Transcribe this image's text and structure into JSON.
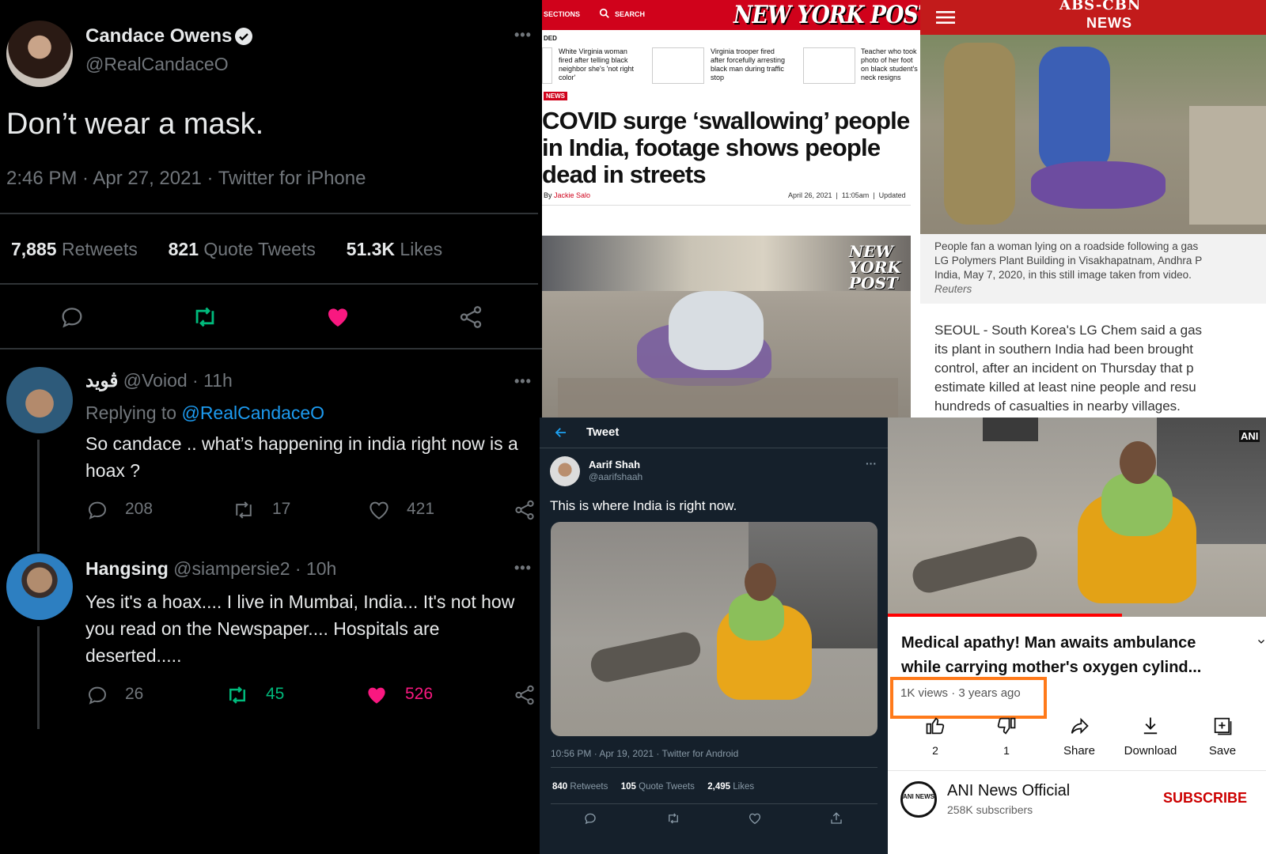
{
  "tweet_main": {
    "name": "Candace Owens",
    "handle": "@RealCandaceO",
    "text": "Don’t wear a mask.",
    "meta": "2:46 PM · Apr 27, 2021 · Twitter for iPhone",
    "retweets_count": "7,885",
    "retweets_label": "Retweets",
    "quotes_count": "821",
    "quotes_label": "Quote Tweets",
    "likes_count": "51.3K",
    "likes_label": "Likes",
    "more": "•••"
  },
  "reply1": {
    "name": "ڤويد",
    "handle_time": "@Voiod · 11h",
    "replying_label": "Replying to",
    "replying_handle": "@RealCandaceO",
    "text": "So candace .. what’s happening in india right now is a hoax ?",
    "replies": "208",
    "retweets": "17",
    "likes": "421",
    "more": "•••"
  },
  "reply2": {
    "name": "Hangsing",
    "handle_time": "@siampersie2 · 10h",
    "text": "Yes it's a hoax.... I live in Mumbai, India... It's not how you read on the Newspaper.... Hospitals are deserted.....",
    "replies": "26",
    "retweets": "45",
    "likes": "526",
    "more": "•••"
  },
  "nypost": {
    "sections": "SECTIONS",
    "search": "SEARCH",
    "logo": "NEW YORK POST",
    "ticker_partial": "DED",
    "related": [
      "White Virginia woman fired after telling black neighbor she's 'not right color'",
      "Virginia trooper fired after forcefully arresting black man during traffic stop",
      "Teacher who took photo of her foot on black student's neck resigns"
    ],
    "tag": "NEWS",
    "headline": "COVID surge ‘swallowing’ people in India, footage shows people dead in streets",
    "byline_prefix": "By",
    "author": "Jackie Salo",
    "date": "April 26, 2021  |  11:05am  |  Updated",
    "watermark": "NEW YORK POST"
  },
  "abscbn": {
    "logo_top": "ABS-CBN",
    "logo_bottom": "NEWS",
    "caption": "People fan a woman lying on a roadside following a gas leak at LG Polymers Plant Building in Visakhapatnam, Andhra Pradesh, India, May 7, 2020, in this still image taken from video.",
    "caption_lines": [
      "People fan a woman lying on a roadside following a gas",
      "LG Polymers Plant Building in Visakhapatnam, Andhra P",
      "India, May 7, 2020, in this still image taken from video."
    ],
    "credit": "Reuters",
    "body_lines": [
      "SEOUL - South Korea's LG Chem said a gas",
      "its plant in southern India had been brought",
      "control, after an incident on Thursday that p",
      "estimate killed at least nine people and resu",
      "hundreds of casualties in nearby villages."
    ]
  },
  "tweet2": {
    "header": "Tweet",
    "name": "Aarif Shah",
    "handle": "@aarifshaah",
    "text": "This is where India is right now.",
    "meta": "10:56 PM · Apr 19, 2021 · Twitter for Android",
    "retweets_count": "840",
    "retweets_label": "Retweets",
    "quotes_count": "105",
    "quotes_label": "Quote Tweets",
    "likes_count": "2,495",
    "likes_label": "Likes",
    "more": "···"
  },
  "youtube": {
    "badge": "ANI",
    "title_line1": "Medical apathy! Man awaits ambulance",
    "title_line2": "while carrying mother's oxygen cylind...",
    "views": "1K views · 3 years ago",
    "likes": "2",
    "dislikes": "1",
    "share": "Share",
    "download": "Download",
    "save": "Save",
    "channel": "ANI News Official",
    "subscribers": "258K subscribers",
    "subscribe": "SUBSCRIBE",
    "channel_avatar_text": "ANI NEWS"
  },
  "colors": {
    "twitter_blue": "#1d9bf0",
    "retweet_green": "#00ba7c",
    "like_pink": "#f91880",
    "nypost_red": "#d0021b",
    "highlight_orange": "#ff7a1a",
    "youtube_red": "#cc0000"
  }
}
